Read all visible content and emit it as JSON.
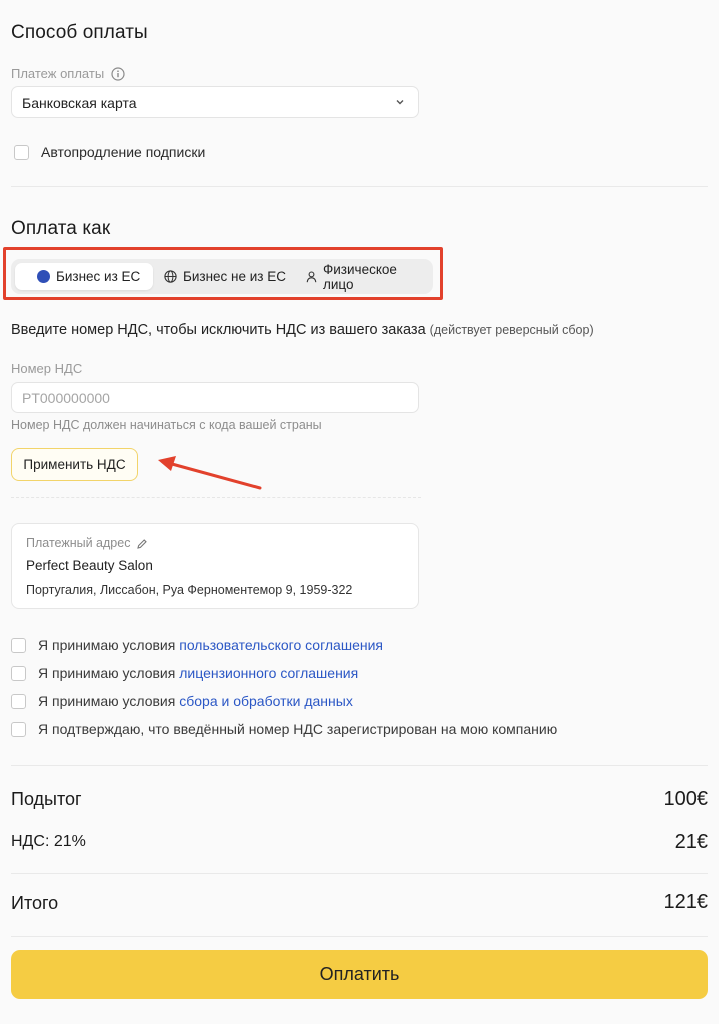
{
  "payment_method": {
    "title": "Способ оплаты",
    "field_label": "Платеж оплаты",
    "selected": "Банковская карта",
    "auto_renew_label": "Автопродление подписки"
  },
  "pay_as": {
    "title": "Оплата как",
    "options": [
      {
        "label": "Бизнес из ЕС",
        "icon": "dot-icon",
        "selected": true
      },
      {
        "label": "Бизнес не из ЕС",
        "icon": "globe-icon",
        "selected": false
      },
      {
        "label": "Физическое лицо",
        "icon": "person-icon",
        "selected": false
      }
    ]
  },
  "vat": {
    "intro": "Введите номер НДС, чтобы исключить НДС из вашего заказа",
    "intro_note": "(действует реверсный сбор)",
    "label": "Номер НДС",
    "placeholder": "PT000000000",
    "hint": "Номер НДС должен начинаться с кода вашей страны",
    "apply_label": "Применить НДС"
  },
  "billing": {
    "title": "Платежный адрес",
    "name": "Perfect Beauty Salon",
    "address": "Португалия, Лиссабон, Руа Ферноментемор 9, 1959-322"
  },
  "terms": [
    {
      "text": "Я принимаю условия ",
      "link": "пользовательского соглашения"
    },
    {
      "text": "Я принимаю условия ",
      "link": "лицензионного соглашения"
    },
    {
      "text": "Я принимаю условия ",
      "link": "сбора и обработки данных"
    },
    {
      "text": "Я подтверждаю, что введённый номер НДС зарегистрирован  на мою компанию",
      "link": ""
    }
  ],
  "summary": {
    "subtotal_label": "Подытог",
    "subtotal_value": "100€",
    "vat_label": "НДС: 21%",
    "vat_value": "21€",
    "total_label": "Итого",
    "total_value": "121€"
  },
  "pay_button": "Оплатить",
  "colors": {
    "accent": "#f5cc43",
    "highlight_red": "#e2412c",
    "link_blue": "#2b57c5"
  }
}
